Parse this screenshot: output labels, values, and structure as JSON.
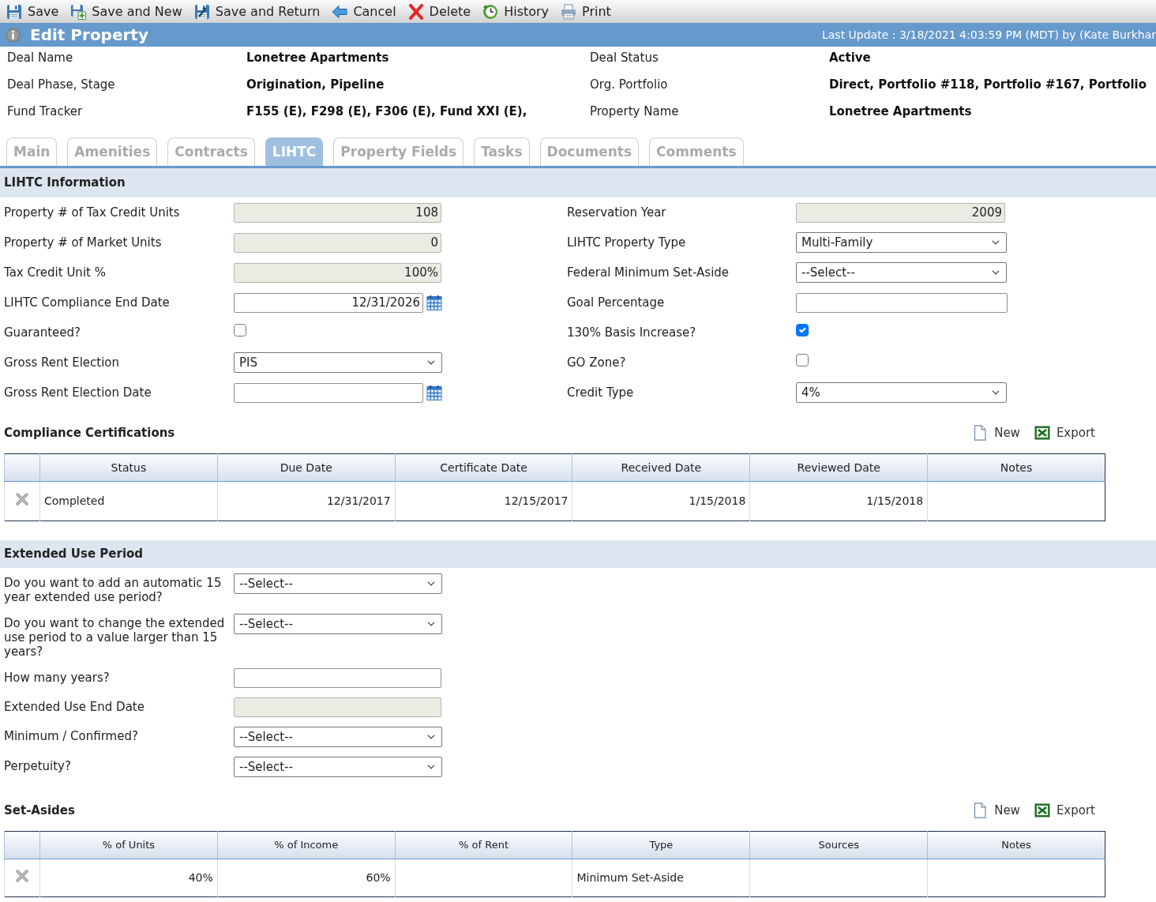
{
  "toolbar": [
    {
      "label": "Save",
      "kind": "save"
    },
    {
      "label": "Save and New",
      "kind": "save_new"
    },
    {
      "label": "Save and Return",
      "kind": "save_return"
    },
    {
      "label": "Cancel",
      "kind": "cancel"
    },
    {
      "label": "Delete",
      "kind": "delete"
    },
    {
      "label": "History",
      "kind": "history"
    },
    {
      "label": "Print",
      "kind": "print"
    }
  ],
  "header": {
    "title": "Edit Property",
    "last_update": "Last Update : 3/18/2021 4:03:59 PM (MDT) by (Kate Burkhar"
  },
  "deal_info": [
    {
      "label": "Deal Name",
      "value": "Lonetree Apartments"
    },
    {
      "label": "Deal Status",
      "value": "Active"
    },
    {
      "label": "Deal Phase, Stage",
      "value": "Origination, Pipeline"
    },
    {
      "label": "Org. Portfolio",
      "value": "Direct, Portfolio #118, Portfolio #167, Portfolio"
    },
    {
      "label": "Fund Tracker",
      "value": "F155 (E), F298 (E), F306 (E), Fund XXI (E),"
    },
    {
      "label": "Property Name",
      "value": "Lonetree Apartments"
    }
  ],
  "tabs": [
    {
      "label": "Main",
      "selected": false
    },
    {
      "label": "Amenities",
      "selected": false
    },
    {
      "label": "Contracts",
      "selected": false
    },
    {
      "label": "LIHTC",
      "selected": true
    },
    {
      "label": "Property Fields",
      "selected": false
    },
    {
      "label": "Tasks",
      "selected": false
    },
    {
      "label": "Documents",
      "selected": false
    },
    {
      "label": "Comments",
      "selected": false
    }
  ],
  "lihtc": {
    "title": "LIHTC Information",
    "fields": [
      {
        "label": "Property # of Tax Credit Units",
        "kind": "readonly",
        "value": "108"
      },
      {
        "label": "Reservation Year",
        "kind": "readonly",
        "value": "2009"
      },
      {
        "label": "Property # of Market Units",
        "kind": "readonly",
        "value": "0"
      },
      {
        "label": "LIHTC Property Type",
        "kind": "select",
        "value": "Multi-Family"
      },
      {
        "label": "Tax Credit Unit %",
        "kind": "readonly",
        "value": "100%"
      },
      {
        "label": "Federal Minimum Set-Aside",
        "kind": "select",
        "value": "--Select--"
      },
      {
        "label": "LIHTC Compliance End Date",
        "kind": "date",
        "value": "12/31/2026"
      },
      {
        "label": "Goal Percentage",
        "kind": "text"
      },
      {
        "label": "Guaranteed?",
        "kind": "checkbox",
        "checked": false
      },
      {
        "label": "130% Basis Increase?",
        "kind": "checkbox",
        "checked": true
      },
      {
        "label": "Gross Rent Election",
        "kind": "select",
        "value": "PIS"
      },
      {
        "label": "GO Zone?",
        "kind": "checkbox",
        "checked": false
      },
      {
        "label": "Gross Rent Election Date",
        "kind": "date"
      },
      {
        "label": "Credit Type",
        "kind": "select",
        "value": "4%"
      }
    ]
  },
  "compliance": {
    "title": "Compliance Certifications",
    "actions": [
      {
        "label": "New",
        "kind": "new"
      },
      {
        "label": "Export",
        "kind": "export"
      }
    ],
    "columns": [
      {
        "label": "Status",
        "kind": "text"
      },
      {
        "label": "Due Date",
        "kind": "date"
      },
      {
        "label": "Certificate Date",
        "kind": "date"
      },
      {
        "label": "Received Date",
        "kind": "date"
      },
      {
        "label": "Reviewed Date",
        "kind": "date"
      },
      {
        "label": "Notes",
        "kind": "text"
      }
    ],
    "rows": [
      {
        "cells": [
          "Completed",
          "12/31/2017",
          "12/15/2017",
          "1/15/2018",
          "1/15/2018"
        ]
      }
    ]
  },
  "extended_use": {
    "title": "Extended Use Period",
    "fields": [
      {
        "label": "Do you want to add an automatic 15 year extended use period?",
        "kind": "select",
        "value": "--Select--"
      },
      {
        "label": "Do you want to change the extended use period to a value larger than 15 years?",
        "kind": "select",
        "value": "--Select--"
      },
      {
        "label": "How many years?",
        "kind": "text"
      },
      {
        "label": "Extended Use End Date",
        "kind": "readonly"
      },
      {
        "label": "Minimum / Confirmed?",
        "kind": "select",
        "value": "--Select--"
      },
      {
        "label": "Perpetuity?",
        "kind": "select",
        "value": "--Select--"
      }
    ]
  },
  "set_asides": {
    "title": "Set-Asides",
    "actions": [
      {
        "label": "New",
        "kind": "new"
      },
      {
        "label": "Export",
        "kind": "export"
      }
    ],
    "columns": [
      {
        "label": "% of Units",
        "kind": "number"
      },
      {
        "label": "% of Income",
        "kind": "number"
      },
      {
        "label": "% of Rent",
        "kind": "number"
      },
      {
        "label": "Type",
        "kind": "text"
      },
      {
        "label": "Sources",
        "kind": "text"
      },
      {
        "label": "Notes",
        "kind": "text"
      }
    ],
    "rows": [
      {
        "cells": [
          "40%",
          "60%",
          null,
          "Minimum Set-Aside"
        ]
      }
    ]
  }
}
